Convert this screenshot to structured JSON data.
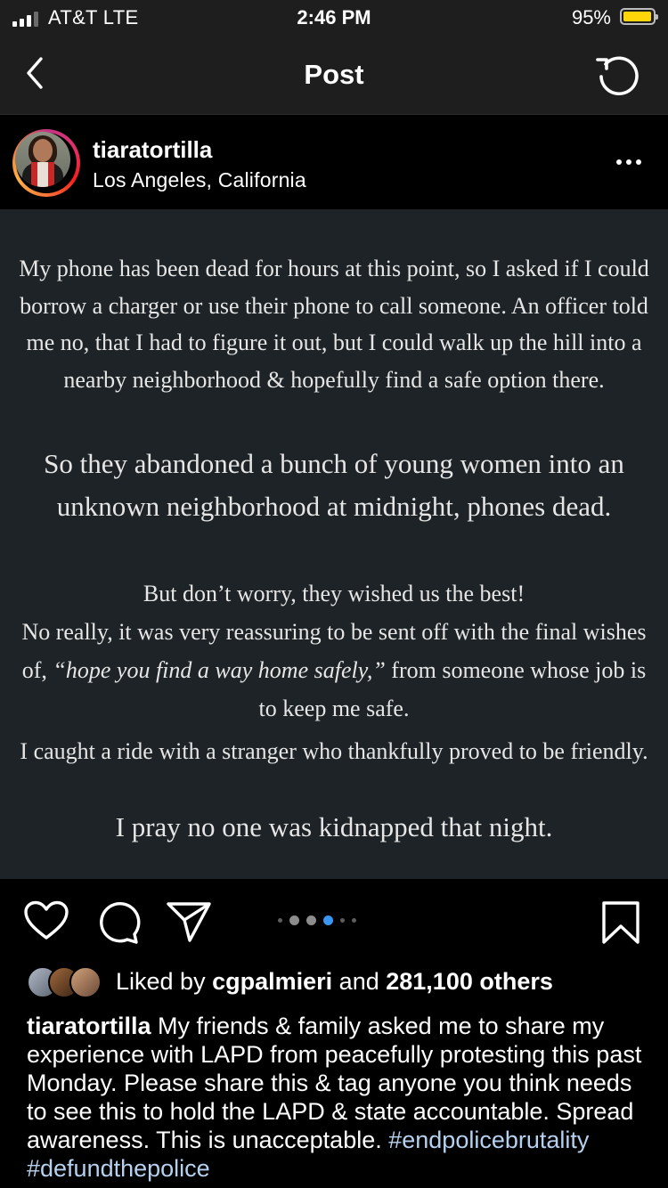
{
  "status_bar": {
    "carrier": "AT&T   LTE",
    "time": "2:46 PM",
    "battery_percent": "95%",
    "battery_level": 0.95,
    "battery_color": "#ffd60a"
  },
  "nav": {
    "title": "Post",
    "back_icon": "chevron-left-icon",
    "refresh_icon": "refresh-icon"
  },
  "post": {
    "username": "tiaratortilla",
    "location": "Los Angeles, California",
    "more_icon": "more-horizontal-icon"
  },
  "story": {
    "p1": "My phone has been dead for hours at this point, so I asked if I could borrow a charger or use their phone to call someone. An officer told me no, that I had to figure it out, but I could walk up the hill into a nearby neighborhood & hopefully find a safe option there.",
    "p2": "So they abandoned a bunch of young women into an unknown neighborhood at midnight, phones dead.",
    "p3_line1": "But don’t worry, they wished us the best!",
    "p3_pre": "No really, it was very reassuring to be sent off with the final wishes of,",
    "p3_quote": "“hope you find a way home safely,”",
    "p3_post": " from someone whose job is to keep me safe.",
    "p4": "I caught a ride with a stranger who thankfully proved to be friendly.",
    "p5": "I pray no one was kidnapped that night."
  },
  "actions": {
    "like_icon": "heart-icon",
    "comment_icon": "comment-icon",
    "share_icon": "paper-plane-icon",
    "save_icon": "bookmark-icon",
    "carousel_total": 6,
    "carousel_active": 4,
    "accent_color": "#3897f0"
  },
  "likes": {
    "prefix": "Liked by",
    "user": "cgpalmieri",
    "middle": "and",
    "count": "281,100 others"
  },
  "caption": {
    "username": "tiaratortilla",
    "text": " My friends & family asked me to share my experience with LAPD from peacefully protesting this past Monday. Please share this & tag anyone you think needs to see this to hold the LAPD & state accountable. Spread awareness. This is unacceptable. ",
    "hashtags": [
      "#endpolicebrutality",
      "#defundthepolice"
    ]
  }
}
